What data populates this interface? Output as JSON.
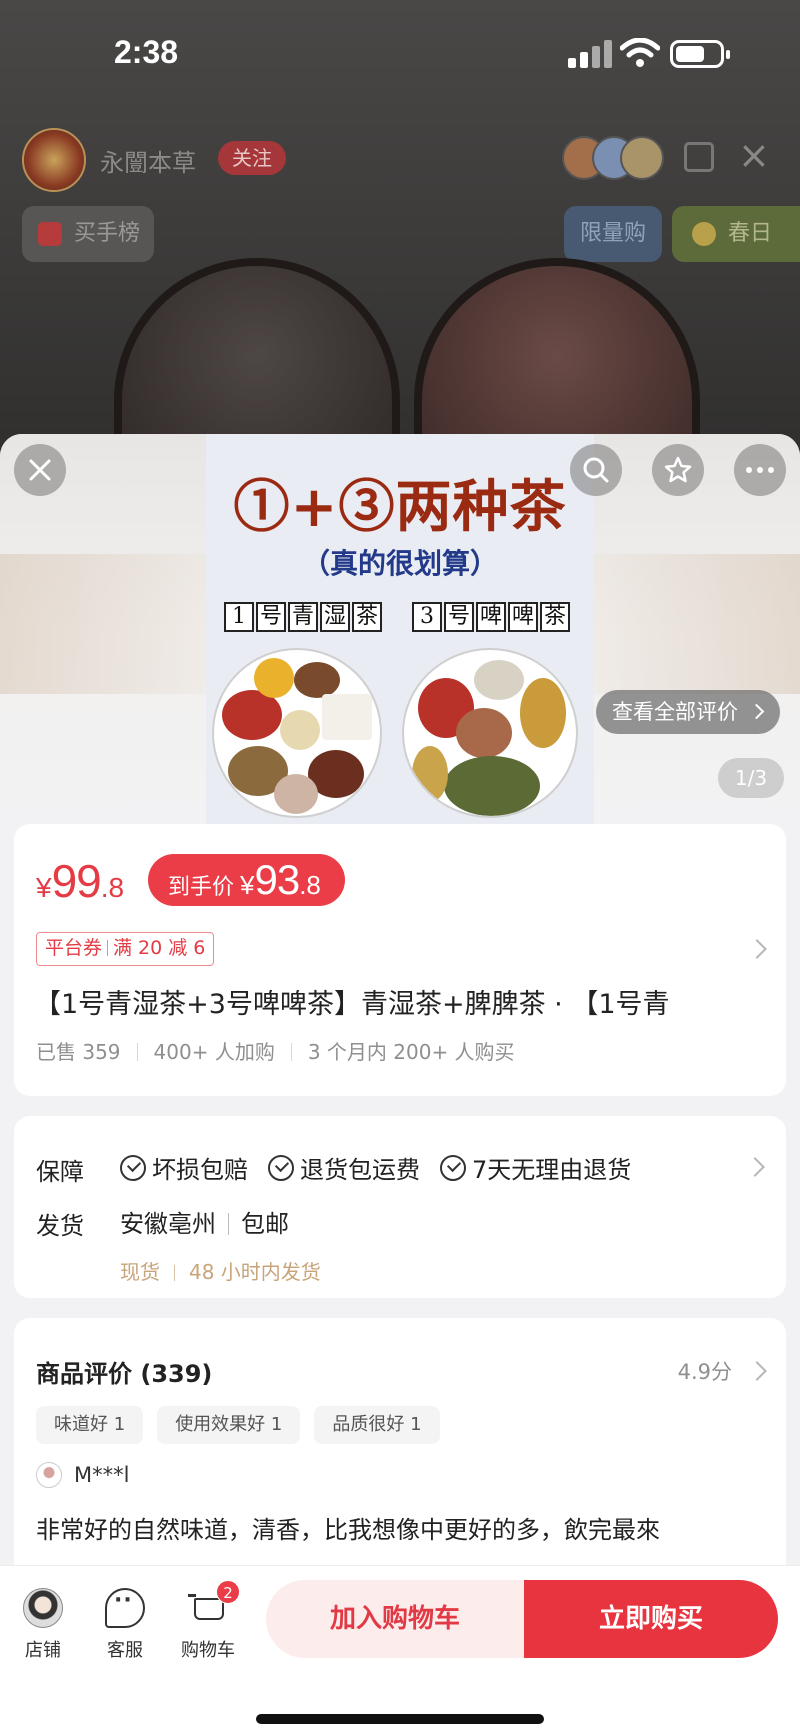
{
  "status_bar": {
    "time": "2:38"
  },
  "live": {
    "shop_name": "永闓本草",
    "follow_label": "关注",
    "rank_label": "买手榜",
    "limited_tag": "限量购",
    "spring_tag": "春日"
  },
  "product_image": {
    "headline": "①+③两种茶",
    "sub": "（真的很划算）",
    "left_label": [
      "1",
      "号",
      "青",
      "湿",
      "茶"
    ],
    "right_label": [
      "3",
      "号",
      "啤",
      "啤",
      "茶"
    ]
  },
  "gallery": {
    "view_all_reviews": "查看全部评价",
    "page_indicator": "1/3"
  },
  "price": {
    "currency": "¥",
    "original_int": "99",
    "original_dec": ".8",
    "final_label": "到手价",
    "final_int": "93",
    "final_dec": ".8",
    "coupon_left": "平台券",
    "coupon_right": "满 20 减 6"
  },
  "product": {
    "title": "【1号青湿茶+3号啤啤茶】青湿茶+脾脾茶 · 【1号青",
    "sold": "已售 359",
    "added": "400+ 人加购",
    "bought": "3 个月内 200+ 人购买"
  },
  "service": {
    "guarantee_label": "保障",
    "guarantees": [
      "坏损包赔",
      "退货包运费",
      "7天无理由退货"
    ],
    "ship_label": "发货",
    "ship_from": "安徽亳州",
    "ship_fee": "包邮",
    "stock": "现货",
    "ship_time": "48 小时内发货"
  },
  "reviews": {
    "title": "商品评价 (339)",
    "score": "4.9分",
    "tags": [
      "味道好 1",
      "使用效果好 1",
      "品质很好 1"
    ],
    "user": "M***l",
    "text": "非常好的自然味道，清香，比我想像中更好的多，飲完最來"
  },
  "bottom_bar": {
    "store_label": "店铺",
    "service_label": "客服",
    "cart_label": "购物车",
    "cart_count": "2",
    "add_to_cart": "加入购物车",
    "buy_now": "立即购买"
  },
  "colors": {
    "accent": "#e7343f",
    "accent_light": "#fcecec",
    "gold": "#c8a47a"
  }
}
